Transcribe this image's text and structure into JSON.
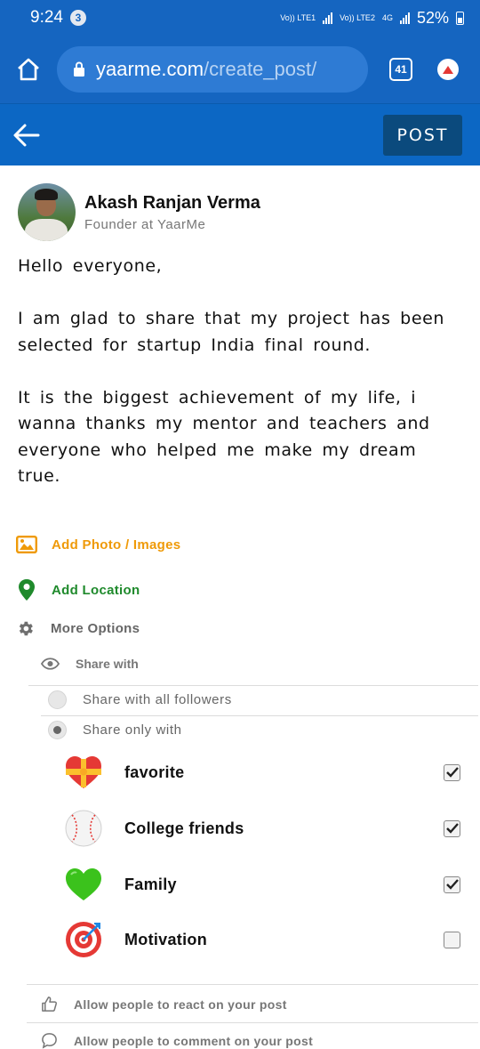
{
  "status_bar": {
    "time": "9:24",
    "notification_count": "3",
    "sim1": "Vo)) LTE1",
    "sim2": "Vo)) LTE2",
    "net": "4G",
    "battery": "52%"
  },
  "browser": {
    "url_host": "yaarme.com",
    "url_path": "/create_post/",
    "tab_count": "41"
  },
  "appbar": {
    "post_label": "POST"
  },
  "author": {
    "name": "Akash Ranjan Verma",
    "role": "Founder at YaarMe"
  },
  "post": {
    "paragraphs": [
      "Hello everyone,",
      "I am glad to share that my project has been selected for startup India final round.",
      "It is the biggest achievement of my life, i wanna thanks my mentor and teachers and everyone who helped me make my dream true."
    ]
  },
  "options": {
    "add_photo": "Add Photo / Images",
    "add_location": "Add Location",
    "more_options": "More Options",
    "share_with": "Share with",
    "share_all": "Share with all followers",
    "share_only": "Share only with",
    "selected_share": "only",
    "groups": [
      {
        "name": "favorite",
        "icon": "heart-ribbon-icon",
        "checked": true
      },
      {
        "name": "College friends",
        "icon": "baseball-icon",
        "checked": true
      },
      {
        "name": "Family",
        "icon": "green-heart-icon",
        "checked": true
      },
      {
        "name": "Motivation",
        "icon": "target-icon",
        "checked": false
      }
    ],
    "allow_react": "Allow people to react on your post",
    "allow_comment": "Allow people to comment on your post"
  },
  "colors": {
    "primary": "#1565c0",
    "appbar": "#0c67c4",
    "post_button": "#0b4a7d",
    "photo": "#ef9a09",
    "location": "#1f8a2c"
  }
}
